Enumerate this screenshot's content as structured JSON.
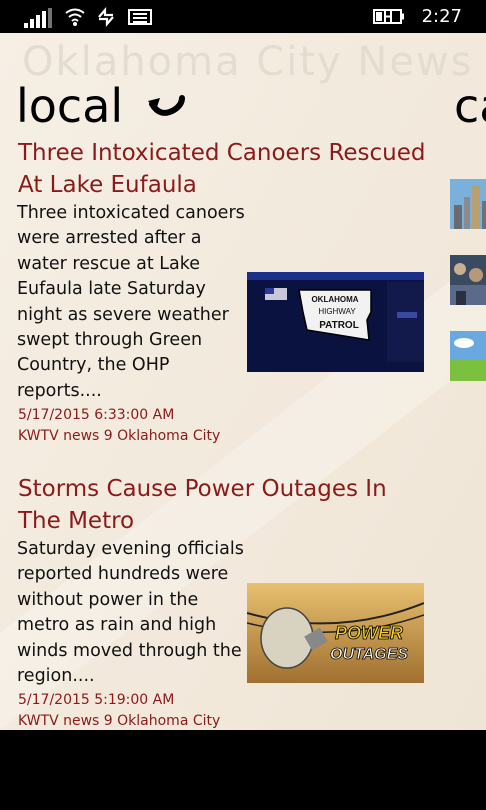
{
  "status_bar": {
    "time": "2:27",
    "icons": [
      "signal-icon",
      "wifi-icon",
      "data-sync-icon",
      "message-icon",
      "battery-charging-icon"
    ]
  },
  "app": {
    "title": "Oklahoma City News",
    "section": "local",
    "next_section_peek": "ca",
    "refresh_icon": "refresh-arrow-icon"
  },
  "stories": [
    {
      "headline": "Three Intoxicated Canoers Rescued At Lake Eufaula",
      "summary": "Three intoxicated canoers were arrested after a water rescue at Lake Eufaula late Saturday night as severe weather swept through Green Country, the OHP reports....",
      "date": "5/17/2015 6:33:00 AM",
      "source": "KWTV news 9 Oklahoma City",
      "thumbnail_text": [
        "OKLAHOMA",
        "HIGHWAY",
        "PATROL"
      ]
    },
    {
      "headline": "Storms Cause Power Outages In The Metro",
      "summary": "Saturday evening officials reported hundreds were without power in the metro as rain and high winds moved through the region....",
      "date": "5/17/2015 5:19:00 AM",
      "source": "KWTV news 9 Oklahoma City",
      "thumbnail_text": [
        "POWER",
        "OUTAGES"
      ]
    }
  ],
  "colors": {
    "accent": "#8b1a1a",
    "background": "#f4ece0",
    "chrome": "#000000"
  }
}
